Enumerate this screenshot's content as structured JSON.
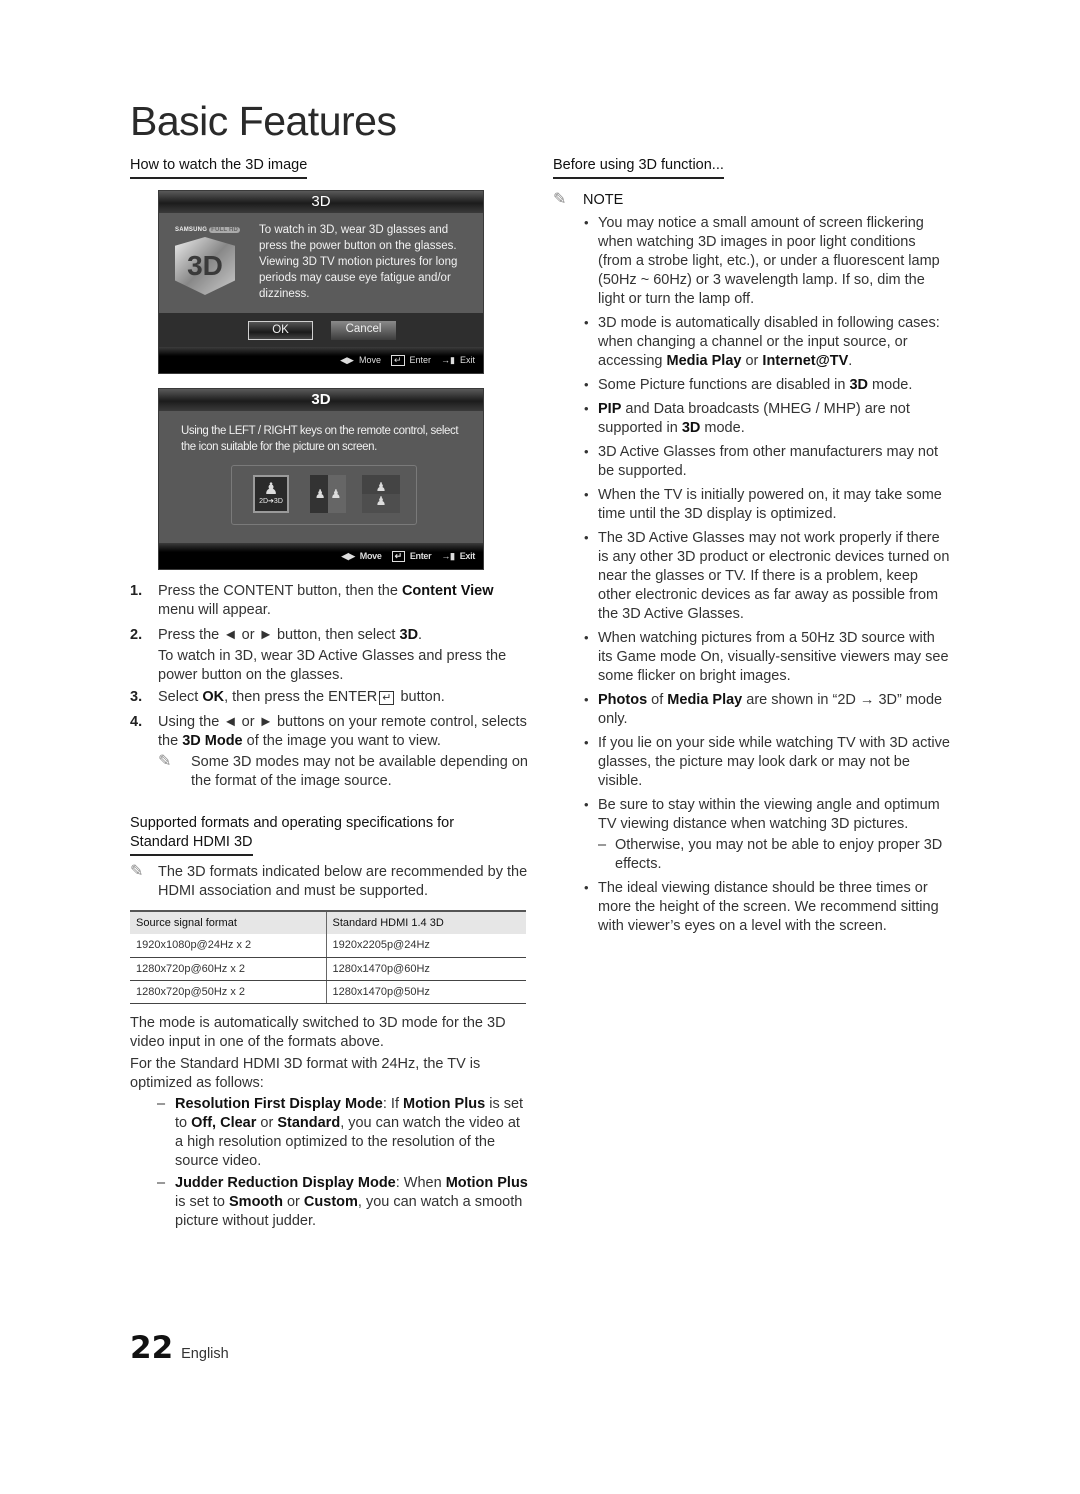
{
  "page_title": "Basic Features",
  "left": {
    "heading": "How to watch the 3D image",
    "tv_screen_1": {
      "title": "3D",
      "logo_brand": "SAMSUNG",
      "logo_badge": "FULL HD",
      "logo_text": "3D",
      "message": "To watch in 3D, wear 3D glasses and press the power button on the glasses. Viewing 3D TV motion pictures for long periods may cause eye fatigue and/or dizziness.",
      "ok_button": "OK",
      "cancel_button": "Cancel",
      "footer": {
        "move_icon": "◀▶",
        "move": "Move",
        "enter_icon": "↵",
        "enter": "Enter",
        "exit_icon": "→▮",
        "exit": "Exit"
      }
    },
    "tv_screen_2": {
      "title": "3D",
      "message": "Using the LEFT / RIGHT keys on the remote control, select the icon suitable for the picture on screen.",
      "modes": [
        {
          "name": "2D to 3D",
          "caption": "2D➔3D"
        },
        {
          "name": "Side by side"
        },
        {
          "name": "Top and bottom"
        }
      ],
      "footer": {
        "move_icon": "◀▶",
        "move": "Move",
        "enter_icon": "↵",
        "enter": "Enter",
        "exit_icon": "→▮",
        "exit": "Exit"
      }
    },
    "steps": [
      {
        "num": "1.",
        "pre": "Press the ",
        "b1": "CONTENT",
        "mid": " button, then the ",
        "b2": "Content View",
        "post": " menu will appear."
      },
      {
        "num": "2.",
        "pre": "Press the ◄ or ► button, then select ",
        "b1": "3D",
        "post": ".",
        "extra": "To watch in 3D, wear 3D Active Glasses and press the power button on the glasses."
      },
      {
        "num": "3.",
        "pre": "Select ",
        "b1": "OK",
        "mid": ", then press the ",
        "b2": "ENTER",
        "enter_icon": "↵",
        "post": " button."
      },
      {
        "num": "4.",
        "pre": "Using the ◄ or ► buttons on your remote control, selects the ",
        "b1": "3D Mode",
        "post": " of the image you want to view.",
        "note": "Some 3D modes may not be available depending on the format of the image source."
      }
    ],
    "hdmi_heading": "Supported formats and operating specifications for Standard HDMI 3D",
    "hdmi_heading_line1": "Supported formats and operating specifications for",
    "hdmi_heading_line2": "Standard HDMI 3D",
    "hdmi_note": "The 3D formats indicated below are recommended by the HDMI association and must be supported.",
    "table": {
      "headers": [
        "Source signal format",
        "Standard HDMI 1.4 3D"
      ],
      "rows": [
        [
          "1920x1080p@24Hz x 2",
          "1920x2205p@24Hz"
        ],
        [
          "1280x720p@60Hz x 2",
          "1280x1470p@60Hz"
        ],
        [
          "1280x720p@50Hz x 2",
          "1280x1470p@50Hz"
        ]
      ]
    },
    "para1": "The mode is automatically switched to 3D mode for the 3D video input in one of the formats above.",
    "para2": "For the Standard HDMI 3D format with 24Hz, the TV is optimized as follows:",
    "dash_items": [
      {
        "b1": "Resolution First Display Mode",
        "t1": ": If ",
        "b2": "Motion Plus",
        "t2": " is set to ",
        "b3": "Off, Clear",
        "t3": " or ",
        "b4": "Standard",
        "t4": ", you can watch the video at a high resolution optimized to the resolution of the source video."
      },
      {
        "b1": "Judder Reduction Display Mode",
        "t1": ": When ",
        "b2": "Motion Plus",
        "t2": " is set to ",
        "b3": "Smooth",
        "t3": " or ",
        "b4": "Custom",
        "t4": ", you can watch a smooth picture without judder."
      }
    ]
  },
  "right": {
    "heading": "Before using 3D function...",
    "note_label": "NOTE",
    "bullets": [
      {
        "text": "You may notice a small amount of screen flickering when watching 3D images in poor light conditions (from a strobe light, etc.), or under a fluorescent lamp (50Hz ~ 60Hz) or 3 wavelength lamp. If so, dim the light or turn the lamp off."
      },
      {
        "pre": "3D mode is automatically disabled in following cases: when changing a channel or the input source, or accessing ",
        "b1": "Media Play",
        "mid": " or ",
        "b2": "Internet@TV",
        "post": "."
      },
      {
        "pre": "Some Picture functions are disabled in ",
        "b1": "3D",
        "post": " mode."
      },
      {
        "b0": "PIP",
        "pre": " and Data broadcasts (MHEG / MHP) are not supported in ",
        "b1": "3D",
        "post": " mode."
      },
      {
        "text": "3D Active Glasses from other manufacturers may not be supported."
      },
      {
        "text": "When the TV is initially powered on, it may take some time until the 3D display is optimized."
      },
      {
        "text": "The 3D Active Glasses may not work properly if there is any other 3D product or electronic devices turned on near the glasses or TV.  If there is a problem, keep other electronic devices as far away as possible from the 3D Active Glasses."
      },
      {
        "text": "When watching pictures from a 50Hz 3D source with its Game mode On, visually-sensitive viewers may see some flicker on bright images."
      },
      {
        "b0": "Photos",
        "pre": " of ",
        "b1": "Media Play",
        "post": " are shown in “2D → 3D” mode only."
      },
      {
        "text": "If you lie on your side while watching TV with 3D active glasses, the picture may look dark or may not be visible."
      },
      {
        "text": "Be sure to stay within the viewing angle and optimum TV viewing distance when watching 3D pictures.",
        "sub": "Otherwise, you may not be able to enjoy proper 3D effects."
      },
      {
        "text": "The ideal viewing distance should be three times or more the height of the screen. We recommend sitting with viewer’s eyes on a level with the screen."
      }
    ]
  },
  "footer": {
    "page_number": "22",
    "language": "English"
  },
  "icons": {
    "pencil": "✎",
    "dash": "–",
    "person": "👤"
  }
}
